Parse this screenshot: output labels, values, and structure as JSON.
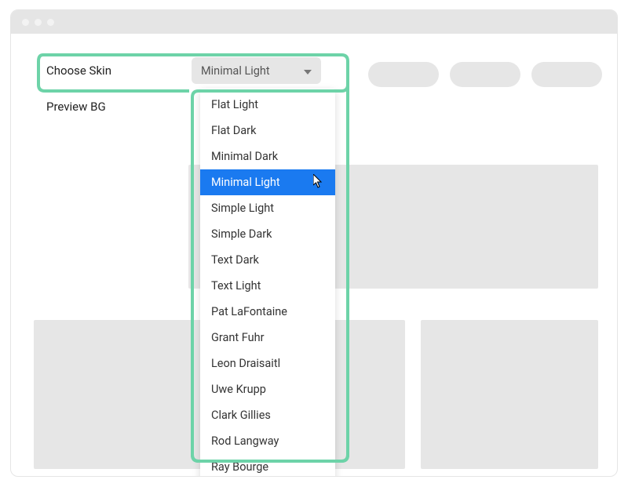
{
  "form": {
    "choose_skin_label": "Choose Skin",
    "preview_bg_label": "Preview BG",
    "selected_skin": "Minimal Light"
  },
  "dropdown": {
    "options": [
      "Flat Light",
      "Flat Dark",
      "Minimal Dark",
      "Minimal Light",
      "Simple Light",
      "Simple Dark",
      "Text Dark",
      "Text Light",
      "Pat LaFontaine",
      "Grant Fuhr",
      "Leon Draisaitl",
      "Uwe Krupp",
      "Clark Gillies",
      "Rod Langway",
      "Ray Bourge"
    ],
    "selected_index": 3
  }
}
